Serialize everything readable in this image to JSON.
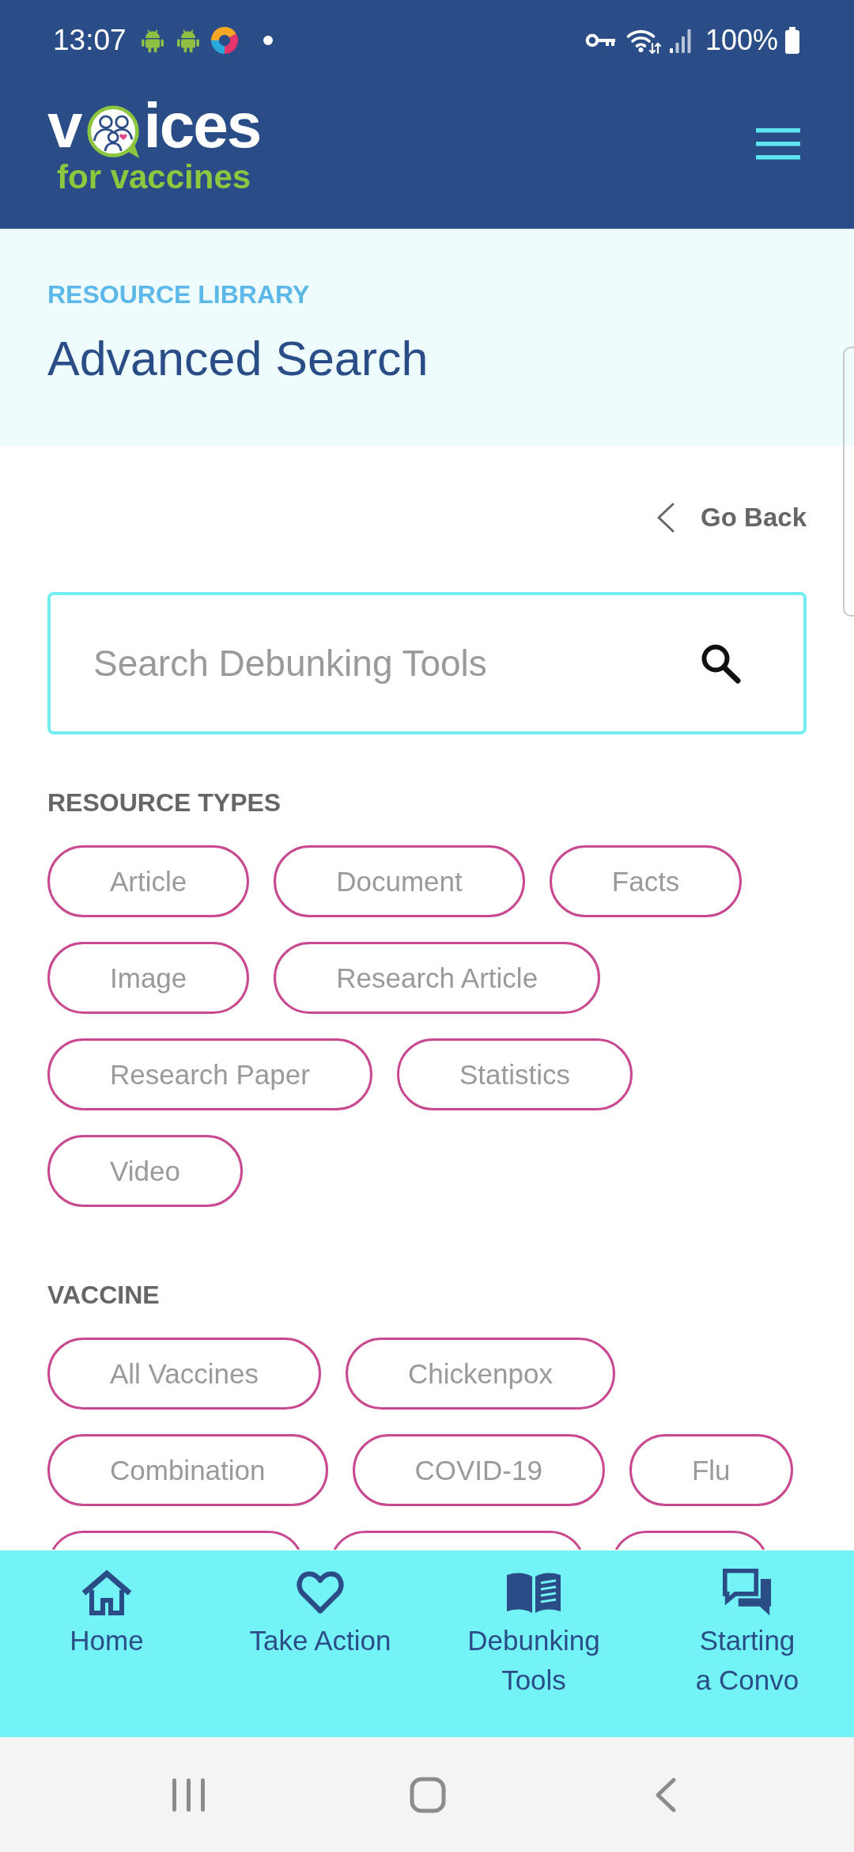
{
  "status_bar": {
    "time": "13:07",
    "battery": "100%"
  },
  "logo": {
    "wordmark_start": "v",
    "wordmark_end": "ices",
    "tagline": "for vaccines"
  },
  "banner": {
    "eyebrow": "RESOURCE LIBRARY",
    "title": "Advanced Search"
  },
  "go_back_link": {
    "label": "Go Back"
  },
  "search": {
    "placeholder": "Search Debunking Tools"
  },
  "filter_groups": [
    {
      "heading": "RESOURCE TYPES",
      "chips": [
        {
          "label": "Article",
          "selected": false
        },
        {
          "label": "Document",
          "selected": false
        },
        {
          "label": "Facts",
          "selected": false
        },
        {
          "label": "Image",
          "selected": false
        },
        {
          "label": "Research Article",
          "selected": false
        },
        {
          "label": "Research Paper",
          "selected": false
        },
        {
          "label": "Statistics",
          "selected": false
        },
        {
          "label": "Video",
          "selected": false
        }
      ]
    },
    {
      "heading": "VACCINE",
      "chips": [
        {
          "label": "All Vaccines",
          "selected": false
        },
        {
          "label": "Chickenpox",
          "selected": false
        },
        {
          "label": "Combination",
          "selected": false
        },
        {
          "label": "COVID-19",
          "selected": false
        },
        {
          "label": "Flu",
          "selected": false
        }
      ],
      "cut_off_chips": [
        {
          "selected": false
        },
        {
          "selected": false
        },
        {
          "selected": false
        }
      ]
    }
  ],
  "bottom_nav": [
    {
      "label": "Home"
    },
    {
      "label": "Take Action"
    },
    {
      "label": "Debunking Tools"
    },
    {
      "label": "Starting a Convo"
    }
  ]
}
